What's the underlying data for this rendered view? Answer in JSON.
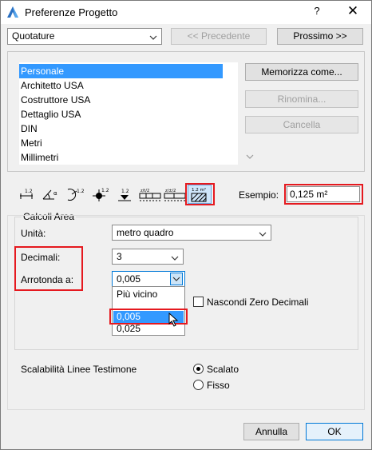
{
  "window": {
    "title": "Preferenze Progetto"
  },
  "titlebar": {
    "help": "?",
    "close": "✕"
  },
  "header": {
    "category_value": "Quotature",
    "prev_label": "<< Precedente",
    "next_label": "Prossimo >>"
  },
  "presets": {
    "items": [
      "Personale",
      "Architetto USA",
      "Costruttore USA",
      "Dettaglio USA",
      "DIN",
      "Metri",
      "Millimetri"
    ],
    "selected_index": 0,
    "save_as_label": "Memorizza come...",
    "rename_label": "Rinomina...",
    "delete_label": "Cancella"
  },
  "toolbar": {
    "icons": [
      {
        "name": "linear-dimension-icon",
        "caption": "1.2"
      },
      {
        "name": "angle-dimension-icon",
        "caption": "α"
      },
      {
        "name": "radial-dimension-icon",
        "caption": "1.2"
      },
      {
        "name": "level-dimension-icon",
        "caption": "1.2"
      },
      {
        "name": "elevation-dimension-icon",
        "caption": "1.2"
      },
      {
        "name": "door-window-dimension-icon",
        "caption": ""
      },
      {
        "name": "sill-height-dimension-icon",
        "caption": ""
      },
      {
        "name": "area-calculation-icon",
        "caption": "1.2 m²"
      }
    ],
    "example_label": "Esempio:",
    "example_value": "0,125 m²"
  },
  "area_calc": {
    "group_title": "Calcoli Area",
    "unit_label": "Unità:",
    "unit_value": "metro quadro",
    "decimals_label": "Decimali:",
    "decimals_value": "3",
    "rounding_label": "Arrotonda a:",
    "rounding_value": "0,005",
    "rounding_options": [
      "Più vicino",
      "",
      "0,005",
      "0,025"
    ],
    "hide_zero_label": "Nascondi Zero Decimali",
    "hide_zero_checked": false
  },
  "witness": {
    "label": "Scalabilità Linee Testimone",
    "option_scaled": "Scalato",
    "option_fixed": "Fisso",
    "selected": "Scalato"
  },
  "footer": {
    "cancel_label": "Annulla",
    "ok_label": "OK"
  },
  "colors": {
    "selection": "#3399ff",
    "highlight_red": "#e5191f",
    "default_button_border": "#0078d7"
  }
}
